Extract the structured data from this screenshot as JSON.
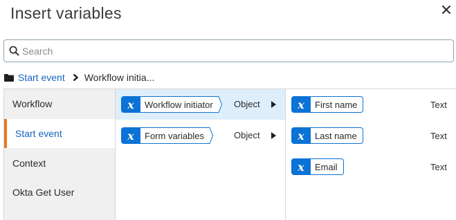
{
  "dialog": {
    "title": "Insert variables"
  },
  "search": {
    "placeholder": "Search",
    "value": ""
  },
  "breadcrumb": {
    "items": [
      "Start event",
      "Workflow initia..."
    ]
  },
  "nav": {
    "items": [
      {
        "label": "Workflow",
        "active": false
      },
      {
        "label": "Start event",
        "active": true
      },
      {
        "label": "Context",
        "active": false
      },
      {
        "label": "Okta Get User",
        "active": false
      }
    ]
  },
  "middle": {
    "rows": [
      {
        "name": "Workflow initiator",
        "type": "Object",
        "selected": true
      },
      {
        "name": "Form variables",
        "type": "Object",
        "selected": false
      }
    ]
  },
  "right": {
    "rows": [
      {
        "name": "First name",
        "type": "Text"
      },
      {
        "name": "Last name",
        "type": "Text"
      },
      {
        "name": "Email",
        "type": "Text"
      }
    ]
  },
  "chip_icon_glyph": "x",
  "icons": {
    "close": "close-icon",
    "search": "search-icon",
    "folder": "folder-icon",
    "breadcrumb_separator": "chevron-right-icon",
    "variable": "variable-x-icon",
    "expand": "caret-right-icon"
  },
  "colors": {
    "accent_blue": "#0b72d6",
    "link_blue": "#1565c0",
    "active_indicator": "#e87722",
    "selected_row": "#dfeefb",
    "nav_background": "#f0f0f0"
  }
}
